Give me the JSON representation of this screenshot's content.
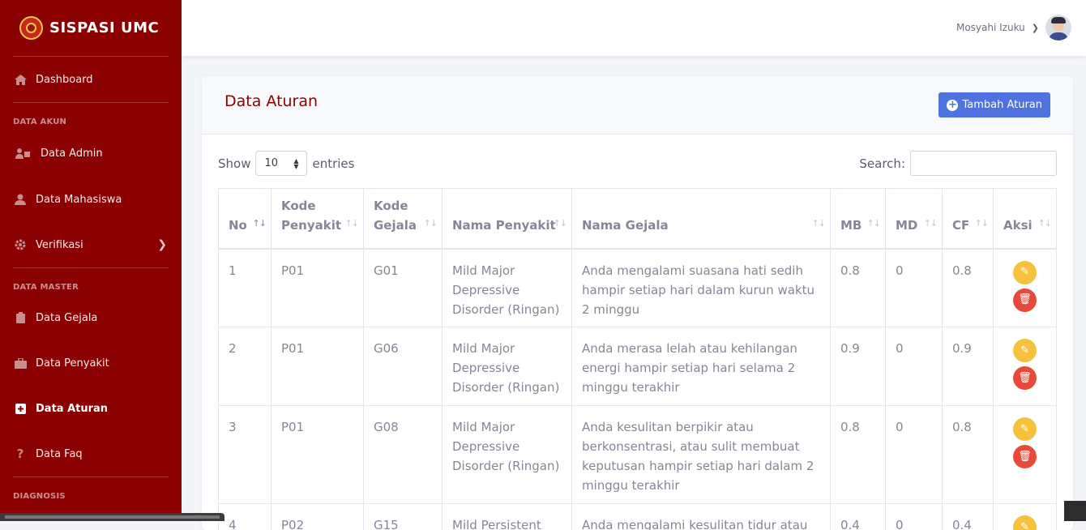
{
  "app": {
    "title": "SISPASI UMC"
  },
  "sidebar": {
    "dashboard": "Dashboard",
    "head_akun": "DATA AKUN",
    "admin": "Data Admin",
    "mahasiswa": "Data Mahasiswa",
    "verifikasi": "Verifikasi",
    "head_master": "DATA MASTER",
    "gejala": "Data Gejala",
    "penyakit": "Data Penyakit",
    "aturan": "Data Aturan",
    "faq": "Data Faq",
    "head_diag": "DIAGNOSIS"
  },
  "user": {
    "name": "Mosyahi Izuku"
  },
  "page": {
    "title": "Data Aturan",
    "add_label": "Tambah Aturan"
  },
  "controls": {
    "show": "Show",
    "entries": "entries",
    "per_page": "10",
    "search": "Search:"
  },
  "table": {
    "headers": [
      "No",
      "Kode Penyakit",
      "Kode Gejala",
      "Nama Penyakit",
      "Nama Gejala",
      "MB",
      "MD",
      "CF",
      "Aksi"
    ],
    "rows": [
      {
        "no": "1",
        "kp": "P01",
        "kg": "G01",
        "np": "Mild Major Depressive Disorder (Ringan)",
        "ng": "Anda mengalami suasana hati sedih hampir setiap hari dalam kurun waktu 2 minggu",
        "mb": "0.8",
        "md": "0",
        "cf": "0.8"
      },
      {
        "no": "2",
        "kp": "P01",
        "kg": "G06",
        "np": "Mild Major Depressive Disorder (Ringan)",
        "ng": "Anda merasa lelah atau kehilangan energi hampir setiap hari selama 2 minggu terakhir",
        "mb": "0.9",
        "md": "0",
        "cf": "0.9"
      },
      {
        "no": "3",
        "kp": "P01",
        "kg": "G08",
        "np": "Mild Major Depressive Disorder (Ringan)",
        "ng": "Anda kesulitan berpikir atau berkonsentrasi, atau sulit membuat keputusan hampir setiap hari dalam 2 minggu terakhir",
        "mb": "0.8",
        "md": "0",
        "cf": "0.8"
      },
      {
        "no": "4",
        "kp": "P02",
        "kg": "G15",
        "np": "Mild Persistent",
        "ng": "Anda mengalami kesulitan tidur atau",
        "mb": "0.4",
        "md": "0",
        "cf": "0.4"
      }
    ]
  }
}
